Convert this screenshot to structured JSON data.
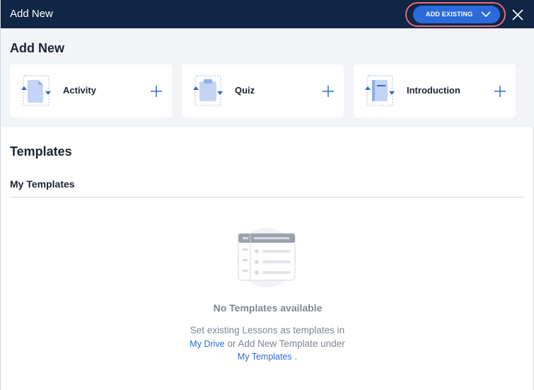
{
  "window": {
    "title": "Add New",
    "add_existing_label": "ADD EXISTING",
    "close_icon": "close-icon"
  },
  "add_new": {
    "title": "Add New",
    "cards": [
      {
        "label": "Activity",
        "icon": "activity-icon"
      },
      {
        "label": "Quiz",
        "icon": "quiz-icon"
      },
      {
        "label": "Introduction",
        "icon": "introduction-icon"
      }
    ]
  },
  "templates": {
    "title": "Templates",
    "my_templates_title": "My Templates",
    "empty_title": "No Templates available",
    "empty_desc_1": "Set existing Lessons as templates in",
    "link_my_drive": "My Drive",
    "empty_desc_2": " or Add New Template under",
    "link_my_templates": "My Templates",
    "empty_desc_3": " ."
  },
  "colors": {
    "header_bg": "#0f2745",
    "accent": "#2b6ad9",
    "highlight_ring": "#e86a7a",
    "section_bg": "#f2f4f8"
  }
}
